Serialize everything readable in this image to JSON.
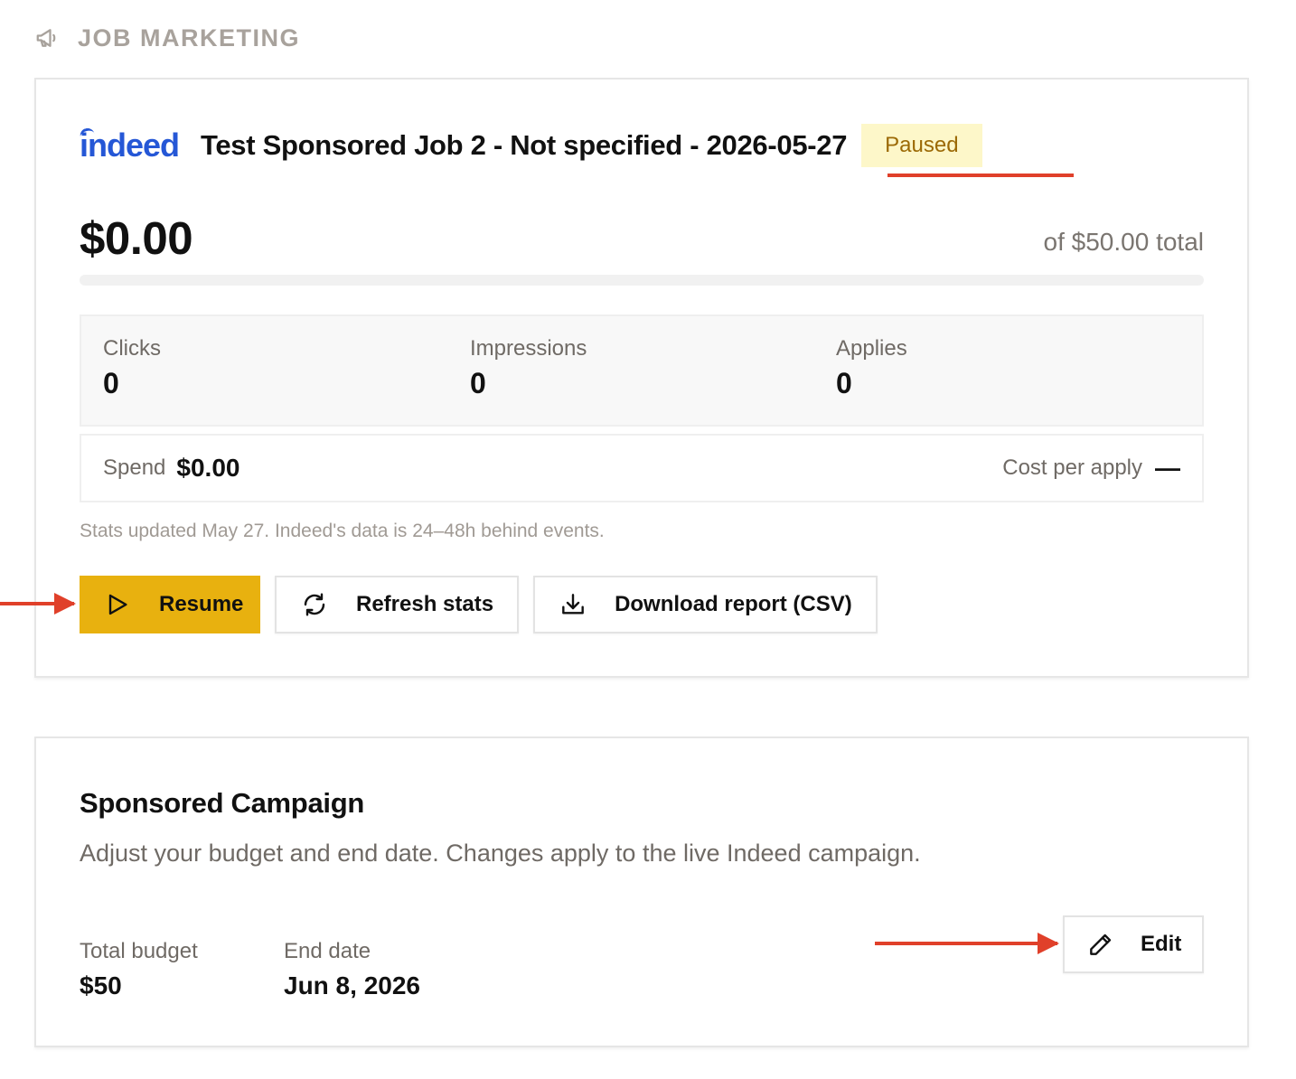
{
  "section": {
    "icon": "megaphone-icon",
    "title": "JOB MARKETING"
  },
  "campaign": {
    "logo_text": "indeed",
    "job_title": "Test Sponsored Job 2 - Not specified - 2026-05-27",
    "status": "Paused",
    "spend_big": "$0.00",
    "budget_total": "of $50.00 total",
    "progress_fraction": 0,
    "stats": [
      {
        "label": "Clicks",
        "value": "0"
      },
      {
        "label": "Impressions",
        "value": "0"
      },
      {
        "label": "Applies",
        "value": "0"
      }
    ],
    "spend_label": "Spend",
    "spend_value": "$0.00",
    "cpa_label": "Cost per apply",
    "cpa_value": "—",
    "stats_note": "Stats updated May 27. Indeed's data is 24–48h behind events.",
    "actions": {
      "resume": "Resume",
      "refresh": "Refresh stats",
      "download": "Download report (CSV)"
    }
  },
  "sponsored": {
    "title": "Sponsored Campaign",
    "description": "Adjust your budget and end date. Changes apply to the live Indeed campaign.",
    "fields": [
      {
        "label": "Total budget",
        "value": "$50"
      },
      {
        "label": "End date",
        "value": "Jun 8, 2026"
      }
    ],
    "edit_label": "Edit"
  },
  "colors": {
    "accent": "#e8b10f",
    "badge_bg": "#fdf7c9",
    "badge_text": "#9c6a06",
    "indeed_blue": "#2557d6",
    "annotation": "#e0402a"
  }
}
